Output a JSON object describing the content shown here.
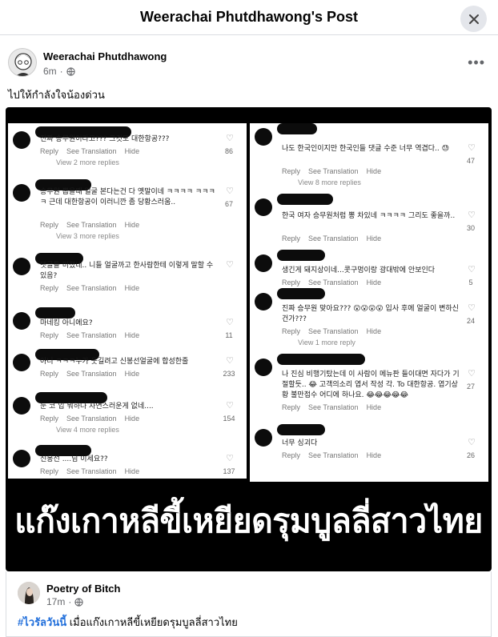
{
  "header": {
    "title": "Weerachai Phutdhawong's Post",
    "close_icon": "close-icon"
  },
  "post": {
    "author": "Weerachai Phutdhawong",
    "time": "6m",
    "privacy_icon": "globe-icon",
    "more_icon": "more-options-icon",
    "caption": "ไปให้กำลังใจน้องด่วน"
  },
  "image": {
    "banner_text": "แก๊งเกาหลีขี้เหยียดรุมบูลลี่สาวไทย",
    "left_comments": [
      {
        "text": "진짜 승무원이라고??? 그것도 대한항공???",
        "reply": "Reply",
        "translate": "See Translation",
        "hide": "Hide",
        "likes": "86",
        "replies": "View 2 more replies"
      },
      {
        "text": "승무원 뽑을때 얼굴 본다는건 다 옛말이네 ㅋㅋㅋㅋ ㅋㅋㅋㅋ 근데 대한항공이 이러니깐 좀 당황스러움..",
        "reply": "Reply",
        "translate": "See Translation",
        "hide": "Hide",
        "likes": "67",
        "replies": "View 3 more replies"
      },
      {
        "text": "댓글들 미쳤네.. 니들 얼굴까고 한사람한테 이렇게 말할 수 있음?",
        "reply": "Reply",
        "translate": "See Translation",
        "hide": "Hide",
        "likes": "",
        "replies": ""
      },
      {
        "text": "마네킹 아니에요?",
        "reply": "Reply",
        "translate": "See Translation",
        "hide": "Hide",
        "likes": "11",
        "replies": ""
      },
      {
        "text": "아니 ㅋㅋㅋ누가 웃길려고 신봉선얼굴에 합성한줄",
        "reply": "Reply",
        "translate": "See Translation",
        "hide": "Hide",
        "likes": "233",
        "replies": ""
      },
      {
        "text": "눈 코 입 뭐하나 자연스러운게 없네....",
        "reply": "Reply",
        "translate": "See Translation",
        "hide": "Hide",
        "likes": "154",
        "replies": "View 4 more replies"
      },
      {
        "text": "신봉선 ....님 이세요??",
        "reply": "Reply",
        "translate": "See Translation",
        "hide": "Hide",
        "likes": "137",
        "replies": ""
      }
    ],
    "right_comments": [
      {
        "text": "나도 한국인이지만 한국인들 댓글 수준 너무 역겹다.. 😓",
        "reply": "Reply",
        "translate": "See Translation",
        "hide": "Hide",
        "likes": "47",
        "replies": "View 8 more replies"
      },
      {
        "text": "한국 여자 승무원처럼 뽕 차있네 ㅋㅋㅋㅋ 그리도 좋을까..",
        "reply": "Reply",
        "translate": "See Translation",
        "hide": "Hide",
        "likes": "30",
        "replies": ""
      },
      {
        "text": "생긴게 돼지상이네...콧구멍이랑 광대밖에 안보인다",
        "reply": "Reply",
        "translate": "See Translation",
        "hide": "Hide",
        "likes": "5",
        "replies": ""
      },
      {
        "text": "진짜 승무원 맞아요??? 😮😮😮😮 입사 후에 얼굴이 변하신건가???",
        "reply": "Reply",
        "translate": "See Translation",
        "hide": "Hide",
        "likes": "24",
        "replies": "View 1 more reply"
      },
      {
        "text": "나 진심 비행기탔는데 이 사람이 메뉴판 들이대면 자다가 기절할듯.. 😂 고객의소리 엽서 작성 각. To 대한항공. 엽기상황 불만접수 어디에 하나요. 😂😂😂😂😂",
        "reply": "Reply",
        "translate": "See Translation",
        "hide": "Hide",
        "likes": "27",
        "replies": ""
      },
      {
        "text": "너무 싱괴다",
        "reply": "Reply",
        "translate": "See Translation",
        "hide": "Hide",
        "likes": "26",
        "replies": ""
      }
    ]
  },
  "shared": {
    "author": "Poetry of Bitch",
    "time": "17m",
    "hashtag": "#ไวรัลวันนี้",
    "text": " เมื่อแก๊งเกาหลีขี้เหยียดรุมบูลลี่สาวไทย"
  }
}
